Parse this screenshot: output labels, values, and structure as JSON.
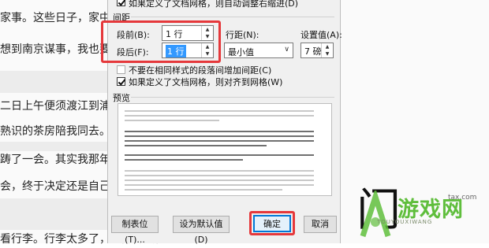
{
  "document": {
    "lines": [
      "家事。这些日子，家中光",
      "想到南京谋事，我也要回",
      "二日上午便须渡江到浦口",
      "熟识的茶房陪我同去。他",
      "踌了一会。其实我那年已",
      "会，终于决定还是自己送",
      "看行李。行李太多了，得向脚夫行些小费"
    ],
    "right_glyph": "门"
  },
  "dialog": {
    "top_checkbox_label": "如果定义了文档网格，则自动调整右缩进(D)",
    "spacing_section": "间距",
    "before_label": "段前(B):",
    "before_value": "1 行",
    "after_label": "段后(F):",
    "after_value": "1 行",
    "line_spacing_label": "行距(N):",
    "line_spacing_value": "最小值",
    "set_value_label": "设置值(A):",
    "set_value": "7 磅",
    "no_space_same_style": "不要在相同样式的段落间增加间距(C)",
    "snap_to_grid": "如果定义了文档网格，则对齐到网格(W)",
    "preview_section": "预览",
    "buttons": {
      "tabs": "制表位(T)...",
      "set_default": "设为默认值(D)",
      "ok": "确定",
      "cancel": "取消"
    }
  },
  "watermark": {
    "brand": "游戏网",
    "sub": "TOUYOUXIWANG",
    "url": "tax.com"
  },
  "colors": {
    "highlight": "#e5383b",
    "accent": "#0078d7",
    "watermark": "#5fbe3c"
  }
}
